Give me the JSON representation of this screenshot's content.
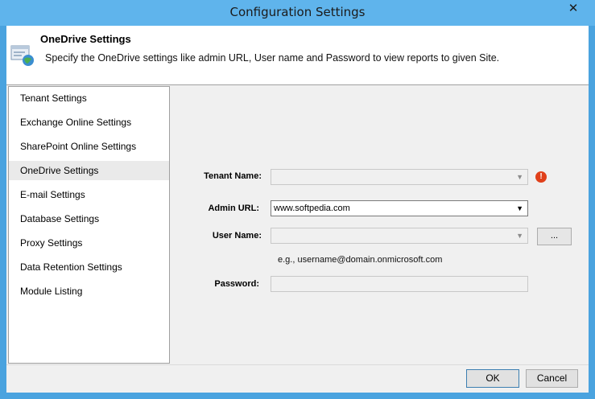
{
  "window": {
    "title": "Configuration Settings",
    "close_glyph": "✕"
  },
  "header": {
    "title": "OneDrive Settings",
    "description": "Specify the OneDrive settings like admin URL, User name and Password to view reports to given Site.",
    "icon": "settings-globe-icon"
  },
  "nav": {
    "items": [
      {
        "label": "Tenant Settings"
      },
      {
        "label": "Exchange Online Settings"
      },
      {
        "label": "SharePoint Online Settings"
      },
      {
        "label": "OneDrive Settings",
        "active": true
      },
      {
        "label": "E-mail Settings"
      },
      {
        "label": "Database Settings"
      },
      {
        "label": "Proxy Settings"
      },
      {
        "label": "Data Retention Settings"
      },
      {
        "label": "Module Listing"
      }
    ]
  },
  "form": {
    "tenant_label": "Tenant Name:",
    "tenant_value": "",
    "tenant_warning": "!",
    "admin_url_label": "Admin URL:",
    "admin_url_value": "www.softpedia.com",
    "username_label": "User Name:",
    "username_value": "",
    "browse_label": "...",
    "username_hint": "e.g., username@domain.onmicrosoft.com",
    "password_label": "Password:",
    "password_value": ""
  },
  "footer": {
    "ok_label": "OK",
    "cancel_label": "Cancel"
  },
  "colors": {
    "titlebar": "#5fb4ec",
    "frame": "#4aa3df",
    "warning": "#e0401a"
  }
}
